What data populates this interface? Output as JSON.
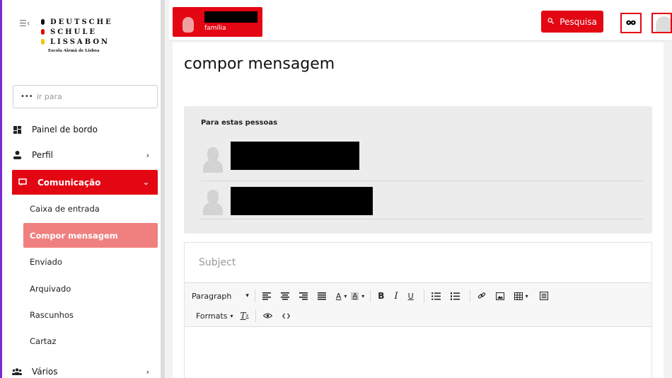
{
  "sidebar": {
    "logo": {
      "line1": "DEUTSCHE",
      "line2": "SCHULE",
      "line3": "LISSABON",
      "subtitle": "Escola Alemã de Lisboa",
      "dot_colors": [
        "#111111",
        "#e30613",
        "#f5c400"
      ]
    },
    "goto": {
      "placeholder": "ir para"
    },
    "items": [
      {
        "label": "Painel de bordo",
        "icon": "dashboard-icon"
      },
      {
        "label": "Perfil",
        "icon": "user-icon",
        "chevron": "›"
      },
      {
        "label": "Comunicação",
        "icon": "chat-icon",
        "chevron": "⌄",
        "active": true
      },
      {
        "label": "Vários",
        "icon": "group-icon",
        "chevron": "›"
      }
    ],
    "sub_items": [
      {
        "label": "Caixa de entrada"
      },
      {
        "label": "Compor mensagem",
        "active": true
      },
      {
        "label": "Enviado"
      },
      {
        "label": "Arquivado"
      },
      {
        "label": "Rascunhos"
      },
      {
        "label": "Cartaz"
      }
    ]
  },
  "topbar": {
    "family_label": "família",
    "search_label": "Pesquisa",
    "mask_icon": "mask-icon",
    "accent_color": "#e30613"
  },
  "main": {
    "title": "compor mensagem",
    "recipients_title": "Para estas pessoas",
    "subject_placeholder": "Subject",
    "toolbar": {
      "paragraph": "Paragraph",
      "formats": "Formats"
    }
  }
}
